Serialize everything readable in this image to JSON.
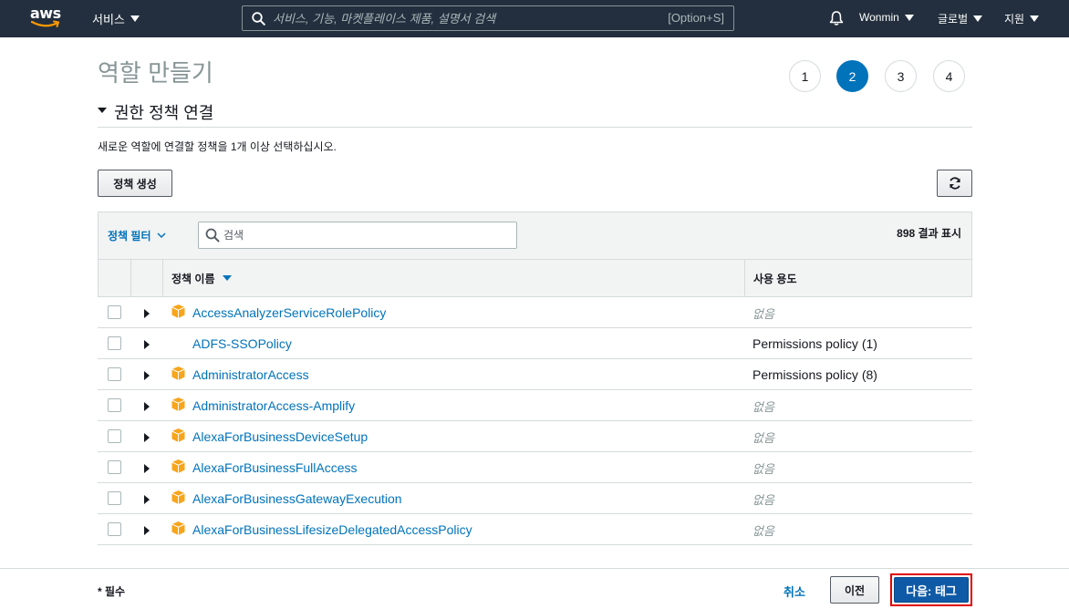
{
  "nav": {
    "logo_text": "aws",
    "services_label": "서비스",
    "search_placeholder": "서비스, 기능, 마켓플레이스 제품, 설명서 검색",
    "search_shortcut": "[Option+S]",
    "user_label": "Wonmin",
    "region_label": "글로벌",
    "support_label": "지원"
  },
  "page": {
    "title": "역할 만들기",
    "steps": [
      "1",
      "2",
      "3",
      "4"
    ],
    "active_step": "2"
  },
  "section": {
    "title": "권한 정책 연결",
    "description": "새로운 역할에 연결할 정책을 1개 이상 선택하십시오.",
    "create_policy_label": "정책 생성"
  },
  "table": {
    "filter_label": "정책 필터",
    "search_placeholder": "검색",
    "result_count": "898 결과 표시",
    "col_name": "정책 이름",
    "col_usage": "사용 용도",
    "rows": [
      {
        "name": "AccessAnalyzerServiceRolePolicy",
        "usage": "없음",
        "aws_managed": true
      },
      {
        "name": "ADFS-SSOPolicy",
        "usage": "Permissions policy (1)",
        "aws_managed": false
      },
      {
        "name": "AdministratorAccess",
        "usage": "Permissions policy (8)",
        "aws_managed": true
      },
      {
        "name": "AdministratorAccess-Amplify",
        "usage": "없음",
        "aws_managed": true
      },
      {
        "name": "AlexaForBusinessDeviceSetup",
        "usage": "없음",
        "aws_managed": true
      },
      {
        "name": "AlexaForBusinessFullAccess",
        "usage": "없음",
        "aws_managed": true
      },
      {
        "name": "AlexaForBusinessGatewayExecution",
        "usage": "없음",
        "aws_managed": true
      },
      {
        "name": "AlexaForBusinessLifesizeDelegatedAccessPolicy",
        "usage": "없음",
        "aws_managed": true
      }
    ]
  },
  "footer": {
    "required_label": "* 필수",
    "cancel_label": "취소",
    "previous_label": "이전",
    "next_label": "다음: 태그"
  },
  "colors": {
    "nav_bg": "#232f3e",
    "link": "#0073bb",
    "primary_button": "#0f5aa6",
    "highlight_border": "#e10000",
    "aws_managed_icon": "#f7a51c"
  }
}
